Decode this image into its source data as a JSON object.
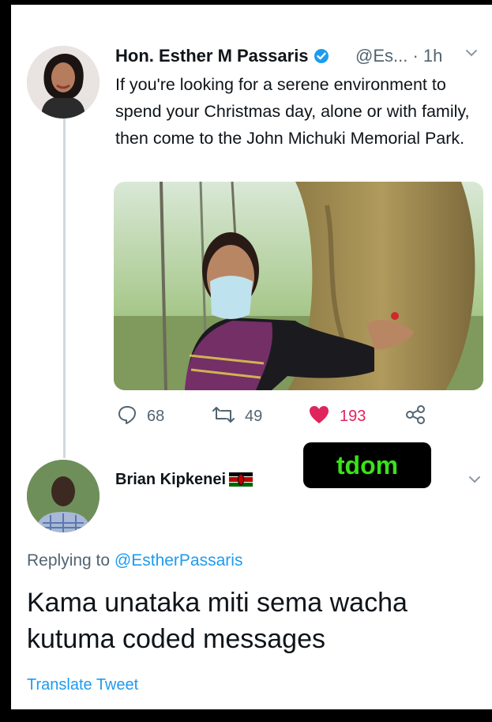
{
  "tweet": {
    "author_name": "Hon. Esther M Passaris",
    "handle": "@Es...",
    "time": "· 1h",
    "text": "If you're looking for a serene environment to spend your Christmas day, alone or with family, then come to the John Michuki Memorial Park.",
    "stats": {
      "replies": "68",
      "retweets": "49",
      "likes": "193"
    },
    "icons": [
      "verified-icon",
      "chevron-down-icon",
      "reply-icon",
      "retweet-icon",
      "heart-icon",
      "share-icon"
    ],
    "colors": {
      "like": "#e0245e",
      "link": "#1d9bf0",
      "verified": "#1d9bf0"
    }
  },
  "reply": {
    "author_name": "Brian Kipkenei",
    "replying_label": "Replying to",
    "replying_handle": "@EstherPassaris",
    "text": "Kama unataka miti sema wacha kutuma coded messages",
    "translate_label": "Translate Tweet"
  },
  "watermark": {
    "text": "tdom",
    "color": "#39e21a"
  }
}
